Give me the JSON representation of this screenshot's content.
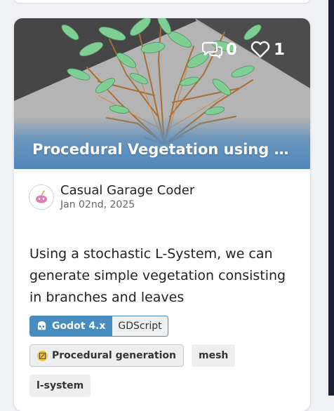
{
  "card": {
    "title": "Procedural Vegetation using L-...",
    "comments": "0",
    "likes": "1",
    "author": "Casual Garage Coder",
    "date": "Jan 02nd, 2025",
    "description": "Using a stochastic L-System, we can generate simple vegetation consisting in branches and leaves",
    "engine_tag": {
      "label": "Godot 4.x",
      "language": "GDScript",
      "icon": "godot-icon",
      "color": "#478cbf"
    },
    "tags": [
      {
        "label": "Procedural generation",
        "icon": "procedural-generation-icon"
      },
      {
        "label": "mesh"
      },
      {
        "label": "l-system"
      }
    ]
  }
}
